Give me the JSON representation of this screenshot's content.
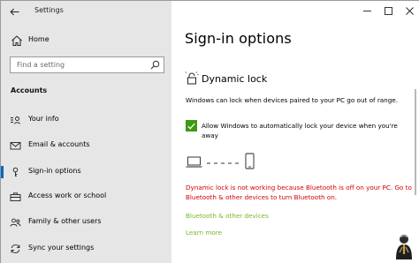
{
  "window": {
    "title": "Settings",
    "controls": [
      "minimize-icon",
      "maximize-icon",
      "close-icon"
    ]
  },
  "sidebar": {
    "home_label": "Home",
    "search_placeholder": "Find a setting",
    "section_label": "Accounts",
    "items": [
      {
        "label": "Your info",
        "icon": "person-info-icon"
      },
      {
        "label": "Email & accounts",
        "icon": "mail-icon"
      },
      {
        "label": "Sign-in options",
        "icon": "key-icon",
        "active": true
      },
      {
        "label": "Access work or school",
        "icon": "briefcase-icon"
      },
      {
        "label": "Family & other users",
        "icon": "people-icon"
      },
      {
        "label": "Sync your settings",
        "icon": "sync-icon"
      }
    ]
  },
  "main": {
    "page_title": "Sign-in options",
    "dynamic_lock": {
      "heading": "Dynamic lock",
      "description": "Windows can lock when devices paired to your PC go out of range.",
      "checkbox_label": "Allow Windows to automatically lock your device when you're away",
      "checkbox_checked": true,
      "error_text": "Dynamic lock is not working because Bluetooth is off on your PC. Go to Bluetooth & other devices to turn Bluetooth on.",
      "bluetooth_link": "Bluetooth & other devices",
      "learn_more_link": "Learn more"
    }
  },
  "colors": {
    "accent": "#0067c0",
    "checkbox": "#3c9a12",
    "error": "#d40000",
    "link": "#78b82a",
    "sidebar_bg": "#e6e6e6"
  }
}
